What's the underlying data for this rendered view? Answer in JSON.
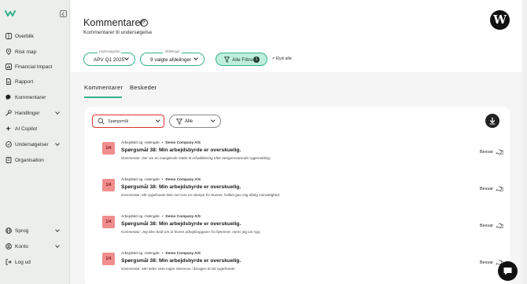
{
  "sidebar": {
    "items": [
      {
        "label": "Overblik",
        "icon": "grid-icon"
      },
      {
        "label": "Risk map",
        "icon": "pin-icon"
      },
      {
        "label": "Financial Impact",
        "icon": "chart-icon"
      },
      {
        "label": "Rapport",
        "icon": "document-icon"
      },
      {
        "label": "Kommentarer",
        "icon": "comment-icon"
      },
      {
        "label": "Handlinger",
        "icon": "tool-icon"
      },
      {
        "label": "AI Copilot",
        "icon": "sparkle-icon"
      },
      {
        "label": "Undersøgelser",
        "icon": "survey-icon"
      },
      {
        "label": "Organisation",
        "icon": "org-icon"
      }
    ],
    "bottom": [
      {
        "label": "Sprog",
        "icon": "globe-icon"
      },
      {
        "label": "Konto",
        "icon": "user-icon"
      },
      {
        "label": "Log ud",
        "icon": "logout-icon"
      }
    ]
  },
  "header": {
    "title": "Kommentarer",
    "help": "?",
    "subtitle": "Kommentarer til undersøgelse",
    "avatar_letter": "W"
  },
  "filters": {
    "survey": {
      "small_label": "Undersøgelse",
      "value": "APV Q1 2025"
    },
    "departments": {
      "small_label": "Afdelinger",
      "value": "9 valgte afdelinger"
    },
    "all_filters": {
      "label": "Alle Filtre",
      "count": "1"
    },
    "clear": "× Ryd alle"
  },
  "tabs": [
    "Kommentarer",
    "Beskeder"
  ],
  "toolbar": {
    "search_value": "Spørgsmål",
    "all_select": "Alle"
  },
  "comments": [
    {
      "badge": "1/4",
      "category": "Arbejdstid og -mængde",
      "company": "Demo Company A/S",
      "question": "Spørgsmål 38: Min arbejdsbyrde er overskuelig.",
      "comment": "Kommentar: Der var en manglende støtte til rehabilitering efter længerevarende sygemelding.",
      "reply": "Besvar"
    },
    {
      "badge": "1/4",
      "category": "Arbejdstid og -mængde",
      "company": "Demo Company A/S",
      "question": "Spørgsmål 38: Min arbejdsbyrde er overskuelig.",
      "comment": "Kommentar: Mit sygefravær blev set som en ulempe for teamet, hvilket gav mig dårlig samvittighed.",
      "reply": "Besvar"
    },
    {
      "badge": "1/4",
      "category": "Arbejdstid og -mængde",
      "company": "Demo Company A/S",
      "question": "Spørgsmål 38: Min arbejdsbyrde er overskuelig.",
      "comment": "Kommentar: Jeg blev bedt om at levere arbejdsopgaver fra hjemmet, mens jeg var syg.",
      "reply": "Besvar"
    },
    {
      "badge": "1/4",
      "category": "Arbejdstid og -mængde",
      "company": "Demo Company A/S",
      "question": "Spørgsmål 38: Min arbejdsbyrde er overskuelig.",
      "comment": "Kommentar: Min leder viste ingen interesse i årsagen til mit sygefravær.",
      "reply": "Besvar"
    }
  ],
  "colors": {
    "accent": "#34b28d",
    "accent_light": "#bfeedd",
    "badge": "#f08d8d",
    "search_border": "#d9332b"
  }
}
